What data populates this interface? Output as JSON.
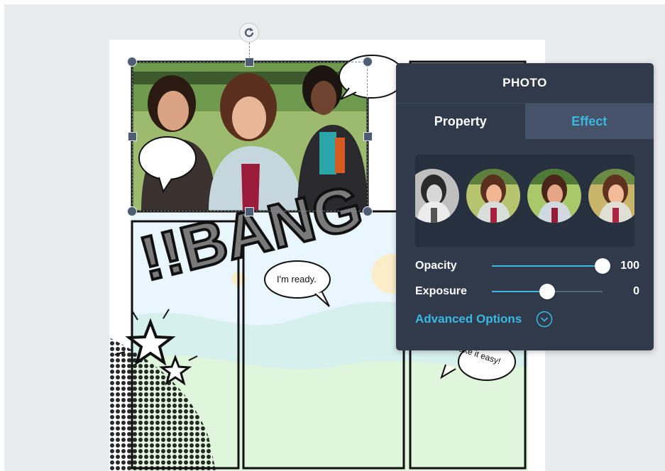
{
  "panel": {
    "title": "PHOTO",
    "tabs": [
      {
        "label": "Property",
        "active": false
      },
      {
        "label": "Effect",
        "active": true
      }
    ],
    "filters": [
      {
        "name": "black-and-white"
      },
      {
        "name": "warm"
      },
      {
        "name": "vivid"
      },
      {
        "name": "original"
      }
    ],
    "opacity": {
      "label": "Opacity",
      "value": "100",
      "level": 1.0
    },
    "exposure": {
      "label": "Exposure",
      "value": "0",
      "level": 0.5
    },
    "advanced_label": "Advanced Options"
  },
  "comic": {
    "sound_effect": "!!BANG",
    "bubble_ready": "I'm ready.",
    "bubble_easy": "Take it easy!"
  },
  "colors": {
    "panel_bg": "#303a4b",
    "accent": "#39b8e3",
    "selection_handle": "#4f5d73"
  }
}
